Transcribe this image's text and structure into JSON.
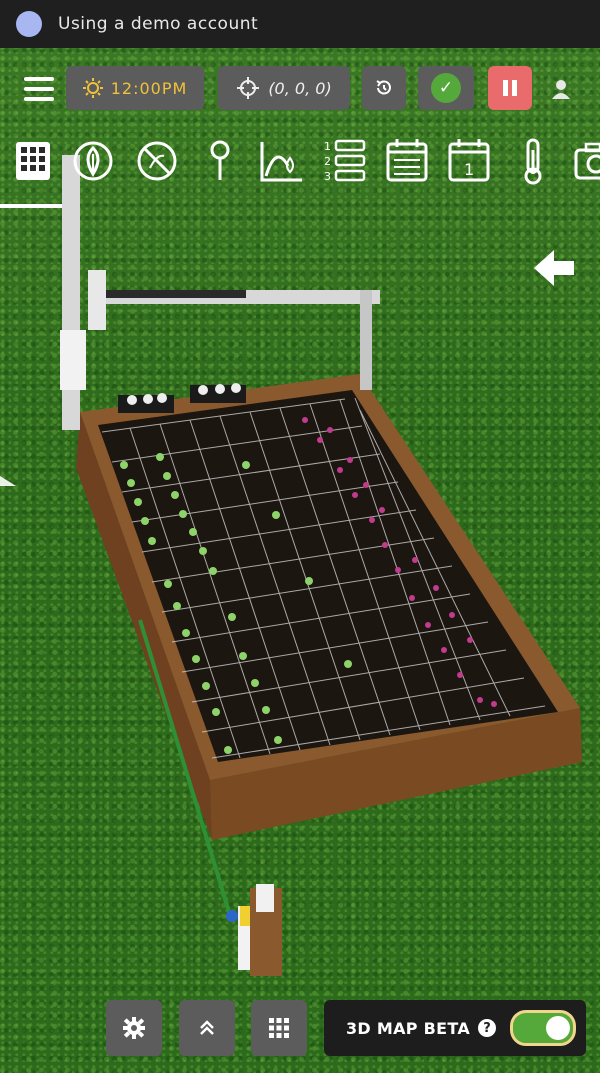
{
  "demo_banner": {
    "text": "Using a demo account"
  },
  "navbar": {
    "time": "12:00PM",
    "position": "(0, 0, 0)",
    "sync_state": "synced",
    "estop_state": "paused"
  },
  "tools": [
    "grid-icon",
    "plant-icon",
    "weed-icon",
    "point-icon",
    "curve-icon",
    "sequence-icon",
    "regimen-icon",
    "event-icon",
    "sensor-icon",
    "camera-icon"
  ],
  "bottom": {
    "toggle_label": "3D MAP BETA",
    "help_glyph": "?",
    "toggle_on": true
  },
  "colors": {
    "accent_time": "#f0c23a",
    "sync_green": "#55a83a",
    "estop_red": "#ea6b6b",
    "pill_gray": "#5c5c5c"
  }
}
